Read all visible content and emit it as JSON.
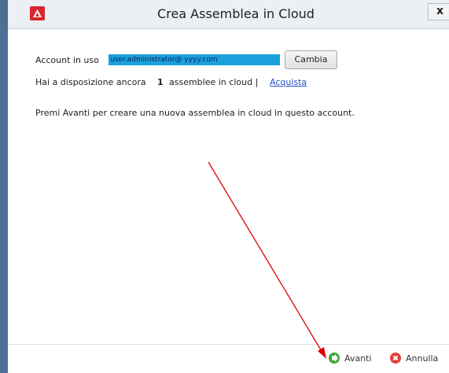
{
  "window": {
    "title": "Crea Assemblea in Cloud",
    "close_label": "x"
  },
  "account": {
    "label": "Account in uso",
    "value": "user.administrator@ yyyy.com",
    "change_button": "Cambia"
  },
  "availability": {
    "prefix": "Hai a disposizione ancora",
    "count": "1",
    "suffix": "assemblee in cloud |",
    "link": "Acquista"
  },
  "instruction": "Premi Avanti per creare una nuova assemblea in cloud in questo account.",
  "footer": {
    "next_label": "Avanti",
    "cancel_label": "Annulla"
  },
  "colors": {
    "accent_red": "#d9262c",
    "selection_blue": "#1aa1dc",
    "annotation_arrow": "#e00000",
    "next_icon": "#3aa83a",
    "cancel_icon": "#e0403a"
  }
}
